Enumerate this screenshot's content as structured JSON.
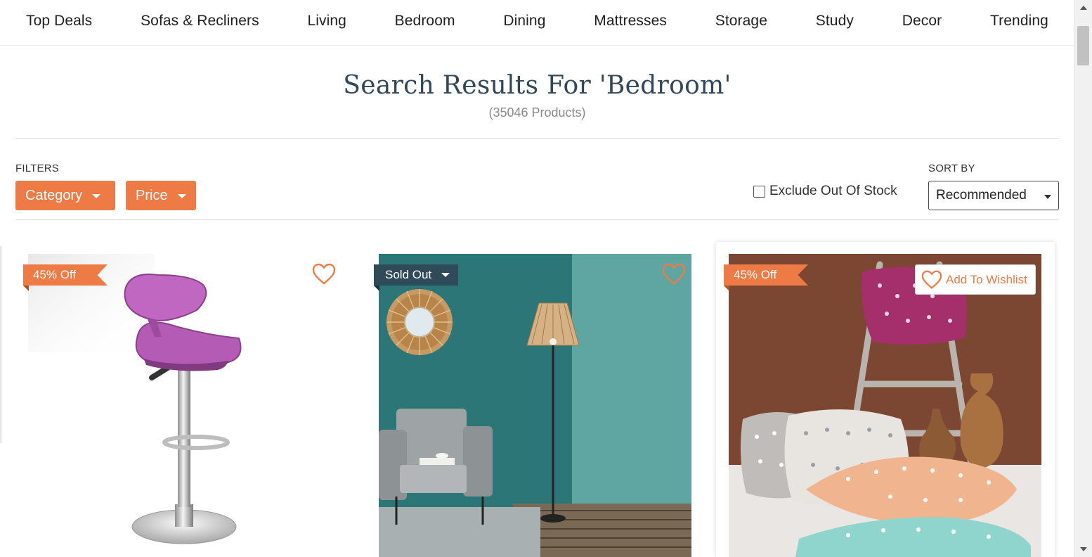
{
  "nav": {
    "items": [
      "Top Deals",
      "Sofas & Recliners",
      "Living",
      "Bedroom",
      "Dining",
      "Mattresses",
      "Storage",
      "Study",
      "Decor",
      "Trending"
    ]
  },
  "results": {
    "title": "Search Results For 'Bedroom'",
    "count": "(35046 Products)"
  },
  "filters": {
    "label": "FILTERS",
    "category_label": "Category",
    "price_label": "Price",
    "exclude_label": "Exclude Out Of Stock",
    "exclude_checked": false
  },
  "sort": {
    "label": "SORT BY",
    "selected": "Recommended"
  },
  "products": [
    {
      "tag": "45% Off",
      "image": "bar-stool-purple"
    },
    {
      "tag": "Sold Out",
      "image": "floor-lamp-teal-room"
    },
    {
      "tag": "45% Off",
      "image": "cushions-ladder",
      "wishlist_label": "Add To Wishlist"
    }
  ],
  "colors": {
    "accent": "#ee7a45",
    "sold_tag": "#2f4b5a",
    "title": "#33475b"
  }
}
